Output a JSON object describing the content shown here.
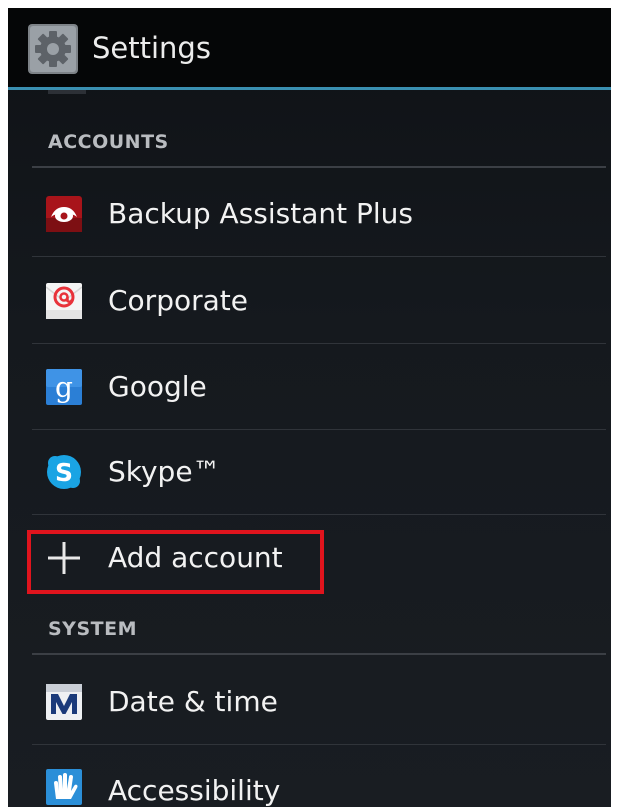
{
  "header": {
    "title": "Settings",
    "icon": "settings-gear-icon"
  },
  "sections": [
    {
      "id": "accounts",
      "header": "ACCOUNTS",
      "items": [
        {
          "label": "Backup Assistant Plus",
          "icon": "backup-assistant-icon"
        },
        {
          "label": "Corporate",
          "icon": "corporate-mail-icon"
        },
        {
          "label": "Google",
          "icon": "google-icon"
        },
        {
          "label": "Skype™",
          "icon": "skype-icon"
        },
        {
          "label": "Add account",
          "icon": "plus-icon"
        }
      ]
    },
    {
      "id": "system",
      "header": "SYSTEM",
      "items": [
        {
          "label": "Date & time",
          "icon": "date-time-icon"
        },
        {
          "label": "Accessibility",
          "icon": "accessibility-hand-icon"
        }
      ]
    }
  ],
  "colors": {
    "accent": "#3a8fb0",
    "highlight": "#e0141d",
    "background": "#15191e",
    "text": "#f2f2f2",
    "section_text": "#b9bcc0"
  }
}
